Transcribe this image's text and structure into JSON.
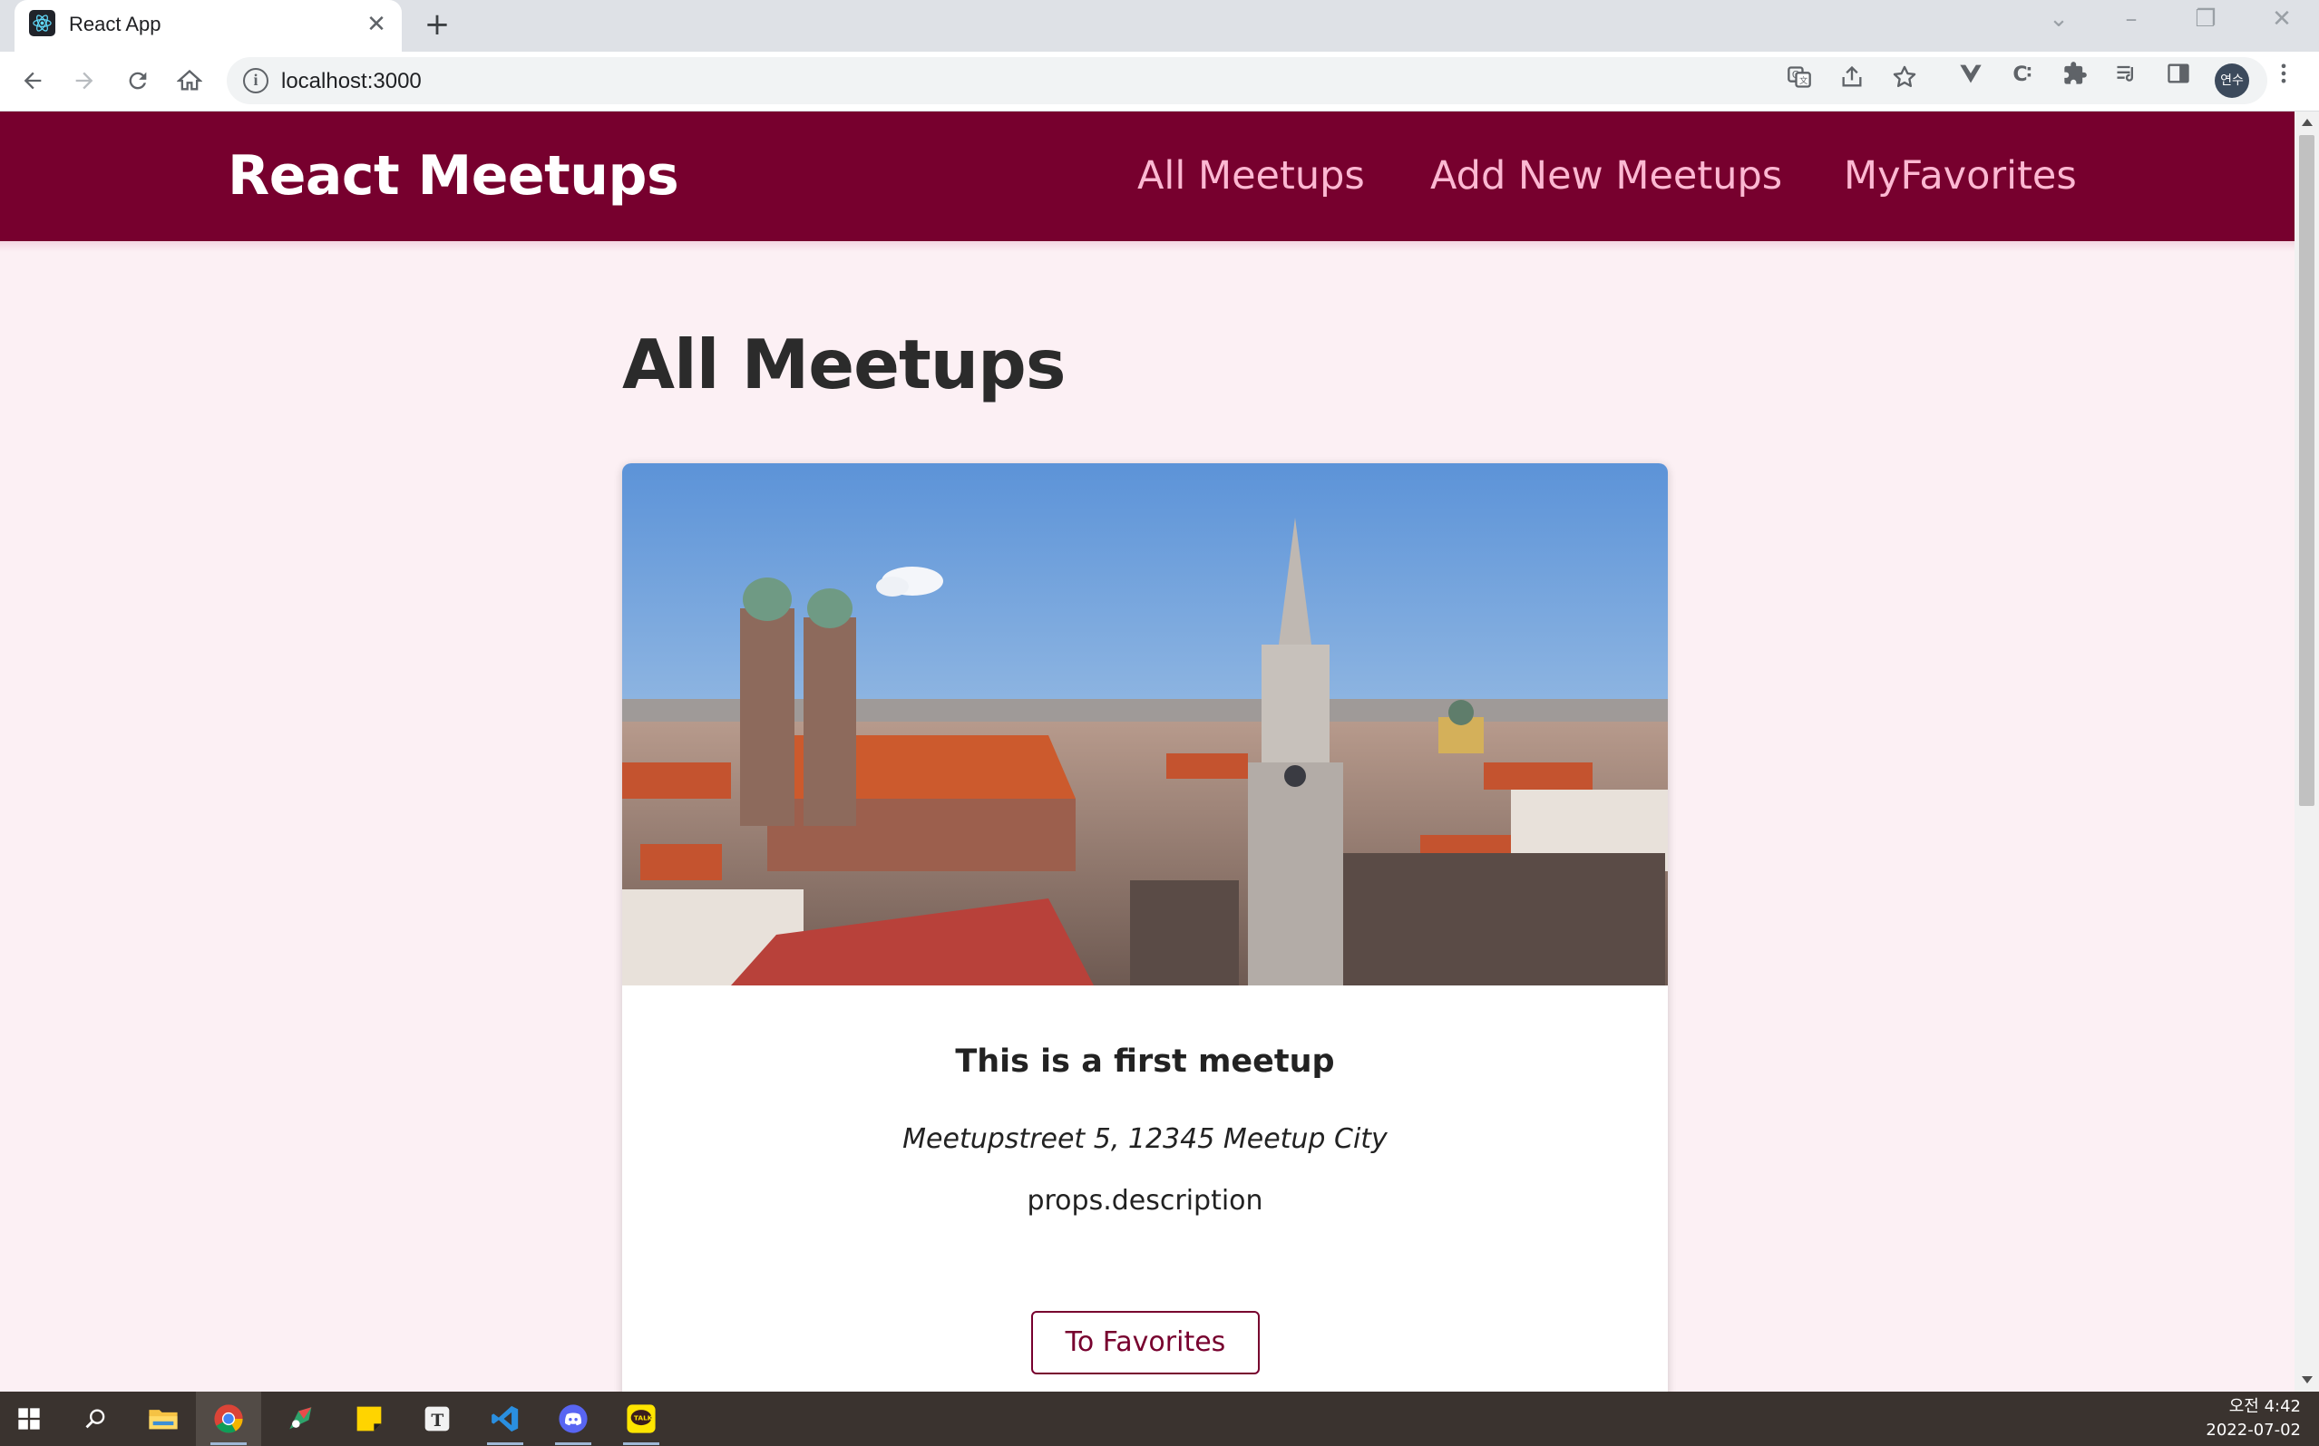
{
  "browser": {
    "tab_title": "React App",
    "tab_close": "✕",
    "new_tab": "+",
    "url": "localhost:3000",
    "profile_label": "연수"
  },
  "app": {
    "logo": "React Meetups",
    "nav": [
      {
        "label": "All Meetups"
      },
      {
        "label": "Add New Meetups"
      },
      {
        "label": "MyFavorites"
      }
    ],
    "page_title": "All Meetups",
    "meetups": [
      {
        "title": "This is a first meetup",
        "address": "Meetupstreet 5, 12345 Meetup City",
        "description": "props.description",
        "button_label": "To Favorites"
      }
    ]
  },
  "taskbar": {
    "time": "오전 4:42",
    "date": "2022-07-02"
  },
  "colors": {
    "header_bg": "#77002e",
    "nav_link": "#fcb8d2",
    "page_bg": "#fcf0f4",
    "button_accent": "#77002e"
  }
}
